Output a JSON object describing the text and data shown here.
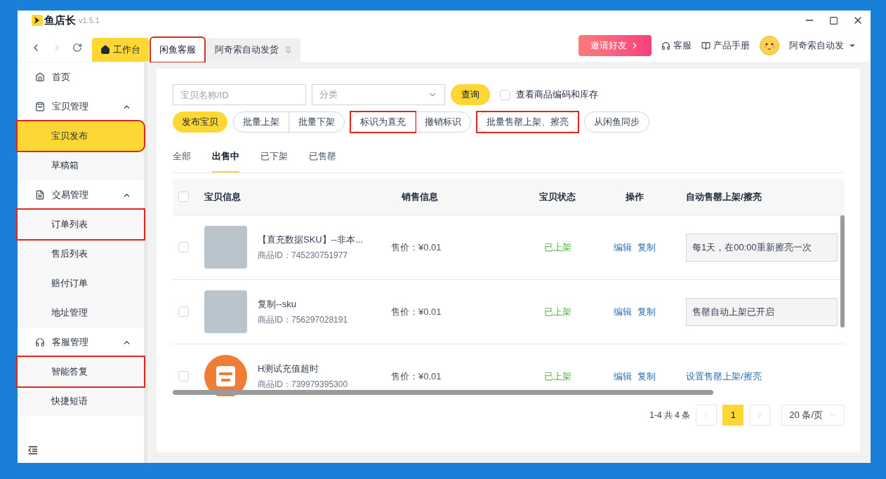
{
  "app": {
    "name": "鱼店长",
    "version": "v1.5.1"
  },
  "nav_tabs": [
    {
      "label": "工作台",
      "kind": "home",
      "selected": false,
      "highlighted": false,
      "pinned": false
    },
    {
      "label": "闲鱼客服",
      "kind": "page",
      "selected": true,
      "highlighted": true,
      "pinned": false
    },
    {
      "label": "阿奇索自动发货",
      "kind": "page",
      "selected": false,
      "highlighted": false,
      "pinned": true
    }
  ],
  "header": {
    "invite_button": "邀请好友",
    "links": [
      {
        "label": "客服",
        "kind": "support"
      },
      {
        "label": "产品手册",
        "kind": "manual"
      }
    ],
    "user": "阿奇索自动发"
  },
  "sidebar": {
    "items": [
      {
        "label": "首页",
        "kind": "home",
        "selected": false,
        "highlighted": false
      },
      {
        "label": "宝贝管理",
        "kind": "goods",
        "expanded": true,
        "children": [
          {
            "label": "宝贝发布",
            "selected": true,
            "highlighted": true
          },
          {
            "label": "草稿箱",
            "selected": false,
            "highlighted": false
          }
        ]
      },
      {
        "label": "交易管理",
        "kind": "orders",
        "expanded": true,
        "children": [
          {
            "label": "订单列表",
            "selected": false,
            "highlighted": true
          },
          {
            "label": "售后列表",
            "selected": false,
            "highlighted": false
          },
          {
            "label": "赔付订单",
            "selected": false,
            "highlighted": false
          },
          {
            "label": "地址管理",
            "selected": false,
            "highlighted": false
          }
        ]
      },
      {
        "label": "客服管理",
        "kind": "service",
        "expanded": true,
        "children": [
          {
            "label": "智能答复",
            "selected": false,
            "highlighted": true
          },
          {
            "label": "快捷短语",
            "selected": false,
            "highlighted": false
          }
        ]
      }
    ]
  },
  "filters": {
    "search": {
      "placeholder": "宝贝名称/ID"
    },
    "category": {
      "placeholder": "分类"
    },
    "query_button": "查询",
    "option": {
      "label": "查看商品编码和库存",
      "checked": false
    }
  },
  "action_groups": [
    {
      "kind": "primary",
      "buttons": [
        {
          "label": "发布宝贝",
          "highlighted": false
        }
      ]
    },
    {
      "kind": "outline",
      "buttons": [
        {
          "label": "批量上架",
          "highlighted": false
        },
        {
          "label": "批量下架",
          "highlighted": false
        }
      ]
    },
    {
      "kind": "outline",
      "buttons": [
        {
          "label": "标识为直充",
          "highlighted": true
        },
        {
          "label": "撤销标识",
          "highlighted": false
        }
      ]
    },
    {
      "kind": "outline",
      "buttons": [
        {
          "label": "批量售罄上架、擦亮",
          "highlighted": true
        }
      ]
    },
    {
      "kind": "outline",
      "buttons": [
        {
          "label": "从闲鱼同步",
          "highlighted": false
        }
      ]
    }
  ],
  "status_tabs": [
    {
      "label": "全部",
      "selected": false
    },
    {
      "label": "出售中",
      "selected": true
    },
    {
      "label": "已下架",
      "selected": false
    },
    {
      "label": "已售罄",
      "selected": false
    }
  ],
  "table": {
    "header_checked": false,
    "columns": [
      "宝贝信息",
      "销售信息",
      "宝贝状态",
      "操作",
      "自动售罄上架/擦亮"
    ],
    "rows": [
      {
        "checked": false,
        "kind": "photo",
        "title": "【直充数据SKU】--非本...",
        "product_id": "商品ID：745230751977",
        "price": "售价：¥0.01",
        "status": "已上架",
        "actions": [
          "编辑",
          "复制"
        ],
        "auto": {
          "kind": "field",
          "text": "每1天，在00:00重新擦亮一次"
        }
      },
      {
        "checked": false,
        "kind": "photo",
        "title": "复制--sku",
        "product_id": "商品ID：756297028191",
        "price": "售价：¥0.01",
        "status": "已上架",
        "actions": [
          "编辑",
          "复制"
        ],
        "auto": {
          "kind": "field",
          "text": "售罄自动上架已开启"
        }
      },
      {
        "checked": false,
        "kind": "logo",
        "title": "H测试充值超时",
        "product_id": "商品ID：739979395300",
        "price": "售价：¥0.01",
        "status": "已上架",
        "actions": [
          "编辑",
          "复制"
        ],
        "auto": {
          "kind": "link",
          "text": "设置售罄上架/擦亮"
        }
      }
    ]
  },
  "pagination": {
    "summary": "1-4 共 4 条",
    "pages": [
      {
        "label": "1",
        "selected": true
      }
    ],
    "page_size": "20 条/页"
  }
}
